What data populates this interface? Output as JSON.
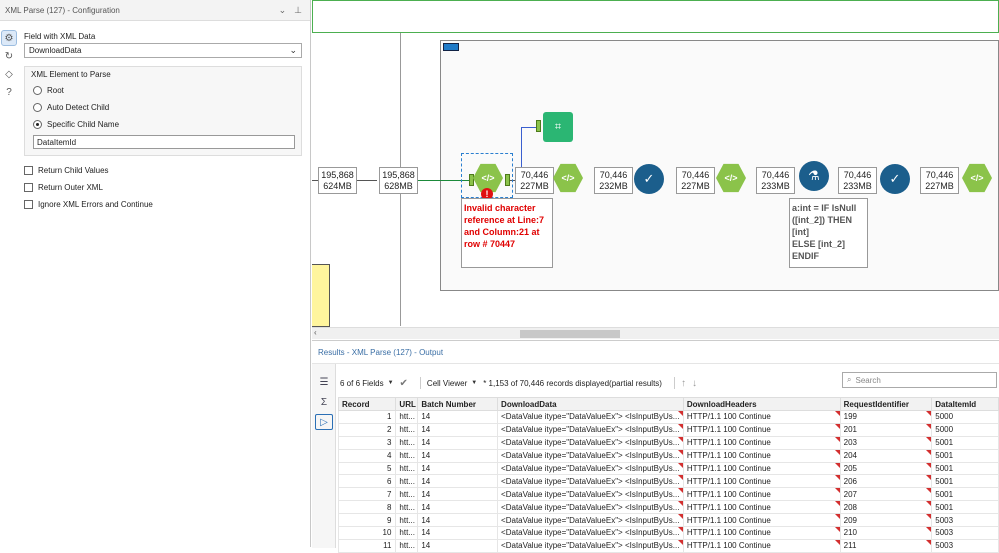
{
  "config": {
    "title": "XML Parse (127) - Configuration",
    "field_label": "Field with XML Data",
    "field_value": "DownloadData",
    "element_group_label": "XML Element to Parse",
    "radio_root": "Root",
    "radio_auto": "Auto Detect Child",
    "radio_specific": "Specific Child Name",
    "child_name_value": "DataItemId",
    "check_return_child": "Return Child Values",
    "check_return_outer": "Return Outer XML",
    "check_ignore_errors": "Ignore XML Errors and Continue"
  },
  "canvas": {
    "counts": [
      {
        "records": "195,868",
        "size": "624MB"
      },
      {
        "records": "195,868",
        "size": "628MB"
      },
      {
        "records": "70,446",
        "size": "227MB"
      },
      {
        "records": "70,446",
        "size": "232MB"
      },
      {
        "records": "70,446",
        "size": "227MB"
      },
      {
        "records": "70,446",
        "size": "233MB"
      },
      {
        "records": "70,446",
        "size": "233MB"
      },
      {
        "records": "70,446",
        "size": "227MB"
      }
    ],
    "error_text": "Invalid character reference at Line:7 and Column:21 at row # 70447",
    "error_badge": "!",
    "formula_text": "a:int = IF IsNull\n([int_2]) THEN\n[int]\nELSE [int_2]\nENDIF"
  },
  "results": {
    "title": "Results - XML Parse (127) - Output",
    "fields_label": "6 of 6 Fields",
    "cell_viewer_label": "Cell Viewer",
    "records_info": "* 1,153 of 70,446 records displayed(partial results)",
    "search_placeholder": "Search",
    "columns": [
      "Record",
      "URL",
      "Batch Number",
      "DownloadData",
      "DownloadHeaders",
      "RequestIdentifier",
      "DataItemId"
    ],
    "rows": [
      [
        "1",
        "htt...",
        "14",
        "<DataValue itype=\"DataValueEx\"> <IsInputByUs...",
        "HTTP/1.1 100 Continue",
        "199",
        "5000"
      ],
      [
        "2",
        "htt...",
        "14",
        "<DataValue itype=\"DataValueEx\"> <IsInputByUs...",
        "HTTP/1.1 100 Continue",
        "201",
        "5000"
      ],
      [
        "3",
        "htt...",
        "14",
        "<DataValue itype=\"DataValueEx\"> <IsInputByUs...",
        "HTTP/1.1 100 Continue",
        "203",
        "5001"
      ],
      [
        "4",
        "htt...",
        "14",
        "<DataValue itype=\"DataValueEx\"> <IsInputByUs...",
        "HTTP/1.1 100 Continue",
        "204",
        "5001"
      ],
      [
        "5",
        "htt...",
        "14",
        "<DataValue itype=\"DataValueEx\"> <IsInputByUs...",
        "HTTP/1.1 100 Continue",
        "205",
        "5001"
      ],
      [
        "6",
        "htt...",
        "14",
        "<DataValue itype=\"DataValueEx\"> <IsInputByUs...",
        "HTTP/1.1 100 Continue",
        "206",
        "5001"
      ],
      [
        "7",
        "htt...",
        "14",
        "<DataValue itype=\"DataValueEx\"> <IsInputByUs...",
        "HTTP/1.1 100 Continue",
        "207",
        "5001"
      ],
      [
        "8",
        "htt...",
        "14",
        "<DataValue itype=\"DataValueEx\"> <IsInputByUs...",
        "HTTP/1.1 100 Continue",
        "208",
        "5001"
      ],
      [
        "9",
        "htt...",
        "14",
        "<DataValue itype=\"DataValueEx\"> <IsInputByUs...",
        "HTTP/1.1 100 Continue",
        "209",
        "5003"
      ],
      [
        "10",
        "htt...",
        "14",
        "<DataValue itype=\"DataValueEx\"> <IsInputByUs...",
        "HTTP/1.1 100 Continue",
        "210",
        "5003"
      ],
      [
        "11",
        "htt...",
        "14",
        "<DataValue itype=\"DataValueEx\"> <IsInputByUs...",
        "HTTP/1.1 100 Continue",
        "211",
        "5003"
      ]
    ]
  }
}
